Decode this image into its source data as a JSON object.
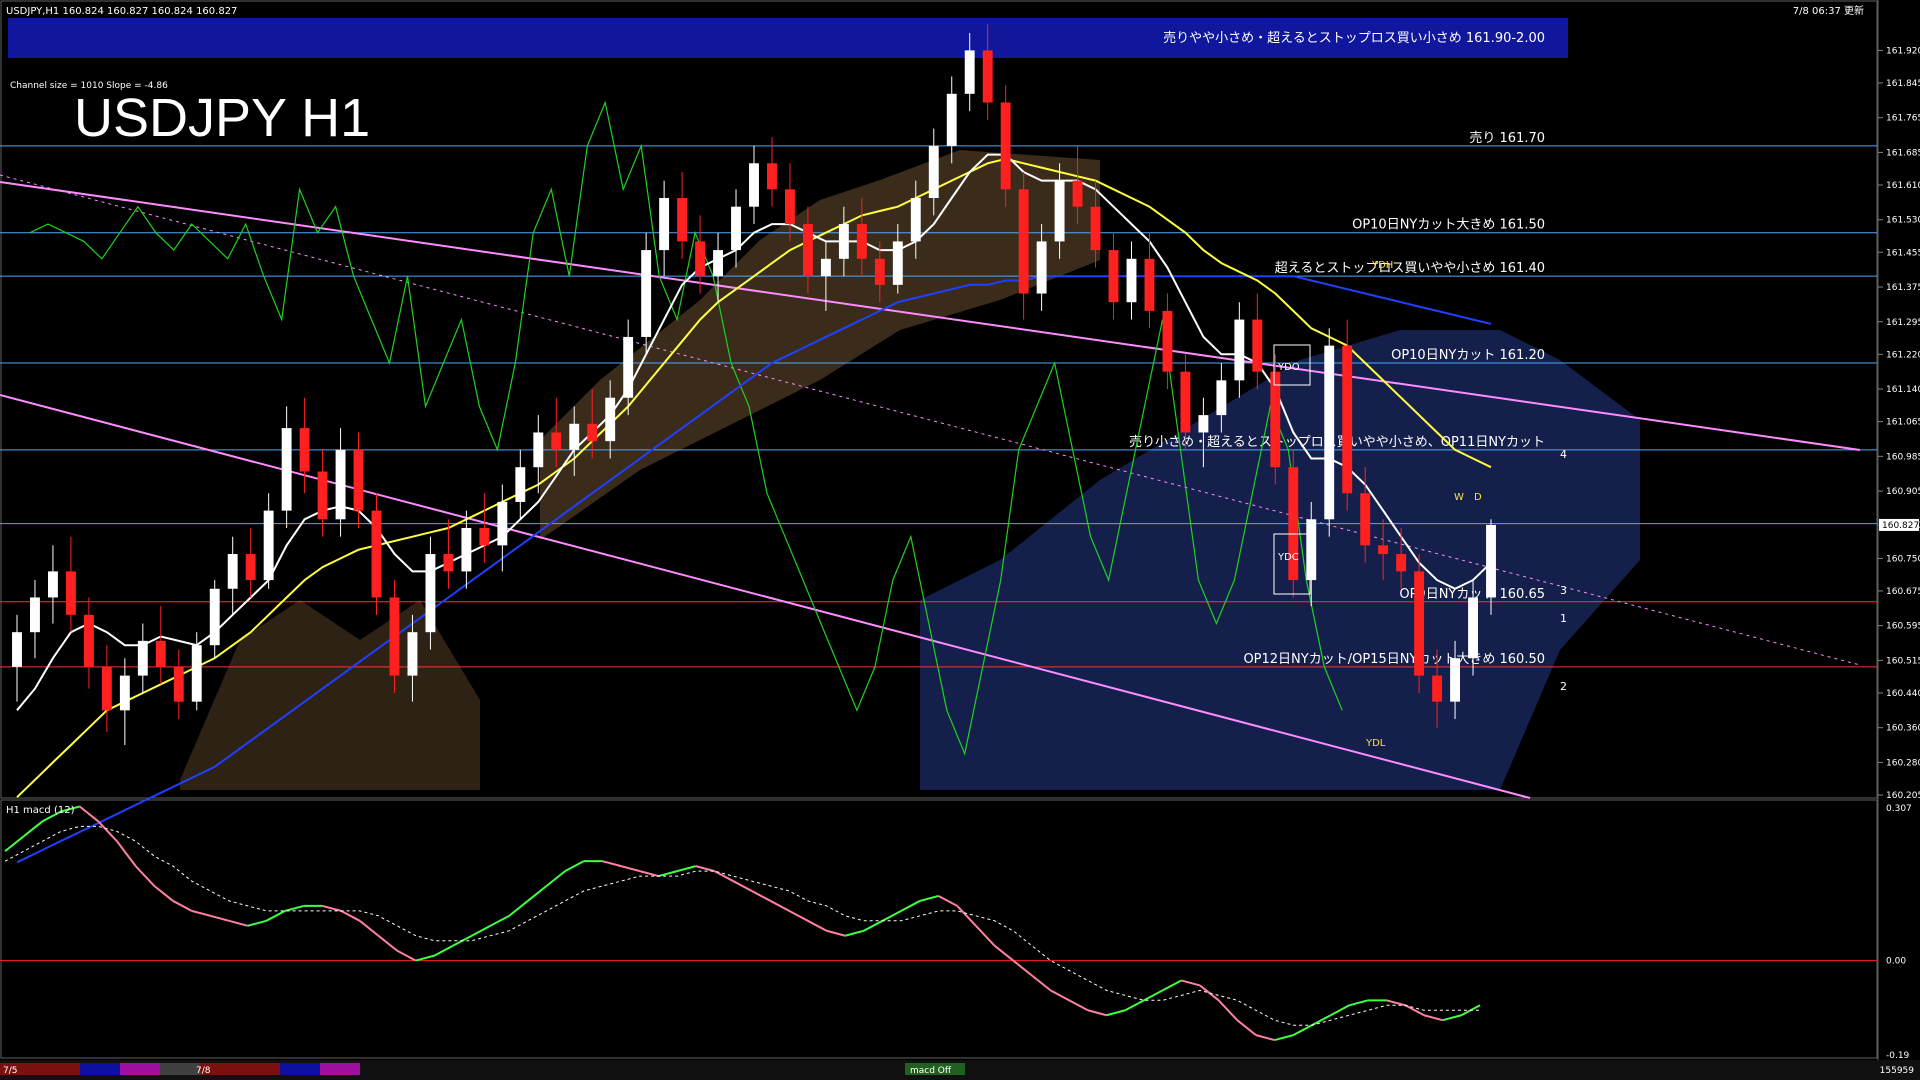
{
  "header": {
    "symbol_info": "USDJPY,H1  160.824 160.827 160.824 160.827",
    "timestamp": "7/8 06:37 更新",
    "channel_info": "Channel size = 1010 Slope = -4.86",
    "big_title": "USDJPY H1"
  },
  "colors": {
    "background": "#000000",
    "bull_candle": "#ffffff",
    "bear_candle": "#ff2020",
    "level_line": "#4aa8ff",
    "red_level": "#ff3030",
    "channel": "#ff8cff",
    "ma_white": "#ffffff",
    "ma_yellow": "#ffff40",
    "ma_blue": "#2040ff",
    "chikou": "#20d020",
    "cloud_blue": "#3a5bd6",
    "cloud_orange": "#d09a60",
    "banner": "#10179c",
    "macd_up": "#40ff40",
    "macd_down": "#ff80a0",
    "signal": "#ffffff"
  },
  "chart_data": [
    {
      "type": "candlestick",
      "title": "USDJPY H1",
      "y_axis_ticks": [
        "161.920",
        "161.845",
        "161.765",
        "161.685",
        "161.610",
        "161.530",
        "161.455",
        "161.375",
        "161.295",
        "161.220",
        "161.140",
        "161.065",
        "160.985",
        "160.905",
        "160.827",
        "160.750",
        "160.675",
        "160.595",
        "160.515",
        "160.440",
        "160.360",
        "160.280",
        "160.205"
      ],
      "ylim": [
        160.205,
        161.99
      ],
      "current_price": "160.827",
      "x_labels": [
        "7/5",
        "7/8"
      ],
      "levels": [
        {
          "label": "売りやや小さめ・超えるとストップロス買い小さめ 161.90-2.00",
          "price": 161.95,
          "kind": "banner"
        },
        {
          "label": "売り 161.70",
          "price": 161.7,
          "kind": "blue"
        },
        {
          "label": "OP10日NYカット大きめ 161.50",
          "price": 161.5,
          "kind": "blue"
        },
        {
          "label": "超えるとストップロス買いやや小さめ 161.40",
          "price": 161.4,
          "kind": "blue"
        },
        {
          "label": "OP10日NYカット 161.20",
          "price": 161.2,
          "kind": "blue"
        },
        {
          "label": "売り小さめ・超えるとストップロス買いやや小さめ、OP11日NYカット",
          "price": 161.0,
          "kind": "blue"
        },
        {
          "label": "",
          "price": 160.83,
          "kind": "blue"
        },
        {
          "label": "OP9日NYカット 160.65",
          "price": 160.65,
          "kind": "red"
        },
        {
          "label": "OP12日NYカット/OP15日NYカット大きめ 160.50",
          "price": 160.5,
          "kind": "red"
        }
      ],
      "box_labels": [
        "YDH",
        "YDO",
        "YDC",
        "YDL",
        "W",
        "D"
      ],
      "wave_labels": [
        "1",
        "2",
        "3",
        "4"
      ],
      "candles": [
        [
          160.5,
          160.62,
          160.42,
          160.58
        ],
        [
          160.58,
          160.7,
          160.52,
          160.66
        ],
        [
          160.66,
          160.78,
          160.6,
          160.72
        ],
        [
          160.72,
          160.8,
          160.58,
          160.62
        ],
        [
          160.62,
          160.66,
          160.45,
          160.5
        ],
        [
          160.5,
          160.55,
          160.35,
          160.4
        ],
        [
          160.4,
          160.52,
          160.32,
          160.48
        ],
        [
          160.48,
          160.6,
          160.44,
          160.56
        ],
        [
          160.56,
          160.64,
          160.46,
          160.5
        ],
        [
          160.5,
          160.54,
          160.38,
          160.42
        ],
        [
          160.42,
          160.58,
          160.4,
          160.55
        ],
        [
          160.55,
          160.7,
          160.52,
          160.68
        ],
        [
          160.68,
          160.8,
          160.62,
          160.76
        ],
        [
          160.76,
          160.82,
          160.66,
          160.7
        ],
        [
          160.7,
          160.9,
          160.68,
          160.86
        ],
        [
          160.86,
          161.1,
          160.82,
          161.05
        ],
        [
          161.05,
          161.12,
          160.9,
          160.95
        ],
        [
          160.95,
          161.0,
          160.8,
          160.84
        ],
        [
          160.84,
          161.05,
          160.8,
          161.0
        ],
        [
          161.0,
          161.04,
          160.82,
          160.86
        ],
        [
          160.86,
          160.9,
          160.62,
          160.66
        ],
        [
          160.66,
          160.7,
          160.44,
          160.48
        ],
        [
          160.48,
          160.62,
          160.42,
          160.58
        ],
        [
          160.58,
          160.8,
          160.54,
          160.76
        ],
        [
          160.76,
          160.84,
          160.68,
          160.72
        ],
        [
          160.72,
          160.86,
          160.68,
          160.82
        ],
        [
          160.82,
          160.9,
          160.74,
          160.78
        ],
        [
          160.78,
          160.92,
          160.72,
          160.88
        ],
        [
          160.88,
          161.0,
          160.84,
          160.96
        ],
        [
          160.96,
          161.08,
          160.9,
          161.04
        ],
        [
          161.04,
          161.12,
          160.96,
          161.0
        ],
        [
          161.0,
          161.1,
          160.94,
          161.06
        ],
        [
          161.06,
          161.14,
          160.98,
          161.02
        ],
        [
          161.02,
          161.16,
          160.98,
          161.12
        ],
        [
          161.12,
          161.3,
          161.08,
          161.26
        ],
        [
          161.26,
          161.5,
          161.22,
          161.46
        ],
        [
          161.46,
          161.62,
          161.4,
          161.58
        ],
        [
          161.58,
          161.64,
          161.44,
          161.48
        ],
        [
          161.48,
          161.54,
          161.36,
          161.4
        ],
        [
          161.4,
          161.5,
          161.34,
          161.46
        ],
        [
          161.46,
          161.6,
          161.42,
          161.56
        ],
        [
          161.56,
          161.7,
          161.52,
          161.66
        ],
        [
          161.66,
          161.72,
          161.56,
          161.6
        ],
        [
          161.6,
          161.66,
          161.48,
          161.52
        ],
        [
          161.52,
          161.56,
          161.36,
          161.4
        ],
        [
          161.4,
          161.48,
          161.32,
          161.44
        ],
        [
          161.44,
          161.56,
          161.4,
          161.52
        ],
        [
          161.52,
          161.58,
          161.4,
          161.44
        ],
        [
          161.44,
          161.48,
          161.34,
          161.38
        ],
        [
          161.38,
          161.52,
          161.36,
          161.48
        ],
        [
          161.48,
          161.62,
          161.44,
          161.58
        ],
        [
          161.58,
          161.74,
          161.54,
          161.7
        ],
        [
          161.7,
          161.86,
          161.66,
          161.82
        ],
        [
          161.82,
          161.96,
          161.78,
          161.92
        ],
        [
          161.92,
          161.98,
          161.76,
          161.8
        ],
        [
          161.8,
          161.84,
          161.56,
          161.6
        ],
        [
          161.6,
          161.64,
          161.3,
          161.36
        ],
        [
          161.36,
          161.52,
          161.32,
          161.48
        ],
        [
          161.48,
          161.66,
          161.44,
          161.62
        ],
        [
          161.62,
          161.7,
          161.52,
          161.56
        ],
        [
          161.56,
          161.62,
          161.42,
          161.46
        ],
        [
          161.46,
          161.5,
          161.3,
          161.34
        ],
        [
          161.34,
          161.48,
          161.3,
          161.44
        ],
        [
          161.44,
          161.5,
          161.28,
          161.32
        ],
        [
          161.32,
          161.36,
          161.14,
          161.18
        ],
        [
          161.18,
          161.22,
          161.0,
          161.04
        ],
        [
          161.04,
          161.12,
          160.96,
          161.08
        ],
        [
          161.08,
          161.2,
          161.04,
          161.16
        ],
        [
          161.16,
          161.34,
          161.12,
          161.3
        ],
        [
          161.3,
          161.36,
          161.14,
          161.18
        ],
        [
          161.18,
          161.22,
          160.92,
          160.96
        ],
        [
          160.96,
          161.0,
          160.66,
          160.7
        ],
        [
          160.7,
          160.88,
          160.64,
          160.84
        ],
        [
          160.84,
          161.28,
          160.8,
          161.24
        ],
        [
          161.24,
          161.3,
          160.86,
          160.9
        ],
        [
          160.9,
          160.96,
          160.74,
          160.78
        ],
        [
          160.78,
          160.84,
          160.7,
          160.76
        ],
        [
          160.76,
          160.82,
          160.68,
          160.72
        ],
        [
          160.72,
          160.76,
          160.44,
          160.48
        ],
        [
          160.48,
          160.54,
          160.36,
          160.42
        ],
        [
          160.42,
          160.56,
          160.38,
          160.52
        ],
        [
          160.52,
          160.7,
          160.48,
          160.66
        ],
        [
          160.66,
          160.84,
          160.62,
          160.827
        ]
      ],
      "ma_white": [
        160.4,
        160.45,
        160.52,
        160.58,
        160.6,
        160.58,
        160.55,
        160.55,
        160.57,
        160.56,
        160.55,
        160.58,
        160.62,
        160.66,
        160.7,
        160.78,
        160.84,
        160.86,
        160.87,
        160.86,
        160.82,
        160.76,
        160.72,
        160.72,
        160.74,
        160.76,
        160.78,
        160.8,
        160.84,
        160.88,
        160.94,
        161.0,
        161.04,
        161.08,
        161.14,
        161.22,
        161.3,
        161.38,
        161.42,
        161.44,
        161.46,
        161.5,
        161.52,
        161.52,
        161.5,
        161.48,
        161.48,
        161.48,
        161.46,
        161.46,
        161.48,
        161.52,
        161.58,
        161.64,
        161.68,
        161.68,
        161.64,
        161.62,
        161.62,
        161.62,
        161.6,
        161.56,
        161.52,
        161.48,
        161.42,
        161.34,
        161.26,
        161.22,
        161.22,
        161.2,
        161.14,
        161.04,
        160.98,
        160.98,
        160.96,
        160.92,
        160.86,
        160.8,
        160.74,
        160.7,
        160.68,
        160.7,
        160.74
      ],
      "ma_yellow": [
        160.2,
        160.24,
        160.28,
        160.32,
        160.36,
        160.4,
        160.42,
        160.44,
        160.46,
        160.48,
        160.5,
        160.52,
        160.55,
        160.58,
        160.62,
        160.66,
        160.7,
        160.73,
        160.75,
        160.77,
        160.78,
        160.79,
        160.8,
        160.81,
        160.82,
        160.84,
        160.86,
        160.88,
        160.9,
        160.92,
        160.95,
        160.98,
        161.02,
        161.06,
        161.1,
        161.15,
        161.2,
        161.25,
        161.3,
        161.34,
        161.37,
        161.4,
        161.43,
        161.46,
        161.48,
        161.5,
        161.52,
        161.54,
        161.55,
        161.56,
        161.58,
        161.6,
        161.62,
        161.64,
        161.66,
        161.67,
        161.66,
        161.65,
        161.64,
        161.63,
        161.62,
        161.6,
        161.58,
        161.56,
        161.53,
        161.5,
        161.46,
        161.43,
        161.41,
        161.39,
        161.36,
        161.32,
        161.28,
        161.26,
        161.24,
        161.2,
        161.16,
        161.12,
        161.08,
        161.04,
        161.0,
        160.98,
        160.96
      ],
      "ma_blue": [
        160.05,
        160.07,
        160.09,
        160.11,
        160.13,
        160.15,
        160.17,
        160.19,
        160.21,
        160.23,
        160.25,
        160.27,
        160.3,
        160.33,
        160.36,
        160.39,
        160.42,
        160.45,
        160.48,
        160.51,
        160.54,
        160.57,
        160.6,
        160.63,
        160.66,
        160.69,
        160.72,
        160.75,
        160.78,
        160.81,
        160.84,
        160.87,
        160.9,
        160.93,
        160.96,
        160.99,
        161.02,
        161.05,
        161.08,
        161.11,
        161.14,
        161.17,
        161.2,
        161.22,
        161.24,
        161.26,
        161.28,
        161.3,
        161.32,
        161.34,
        161.35,
        161.36,
        161.37,
        161.38,
        161.38,
        161.39,
        161.39,
        161.4,
        161.4,
        161.4,
        161.4,
        161.4,
        161.4,
        161.4,
        161.4,
        161.4,
        161.4,
        161.4,
        161.4,
        161.4,
        161.4,
        161.4,
        161.39,
        161.38,
        161.37,
        161.36,
        161.35,
        161.34,
        161.33,
        161.32,
        161.31,
        161.3,
        161.29
      ],
      "chikou": [
        161.5,
        161.52,
        161.5,
        161.48,
        161.44,
        161.5,
        161.56,
        161.5,
        161.46,
        161.52,
        161.48,
        161.44,
        161.52,
        161.4,
        161.3,
        161.6,
        161.5,
        161.56,
        161.4,
        161.3,
        161.2,
        161.4,
        161.1,
        161.2,
        161.3,
        161.1,
        161.0,
        161.2,
        161.5,
        161.6,
        161.4,
        161.7,
        161.8,
        161.6,
        161.7,
        161.4,
        161.3,
        161.5,
        161.4,
        161.2,
        161.1,
        160.9,
        160.8,
        160.7,
        160.6,
        160.5,
        160.4,
        160.5,
        160.7,
        160.8,
        160.6,
        160.4,
        160.3,
        160.5,
        160.7,
        161.0,
        161.1,
        161.2,
        161.0,
        160.8,
        160.7,
        160.9,
        161.1,
        161.3,
        161.0,
        160.7,
        160.6,
        160.7,
        160.9,
        161.1,
        161.0,
        160.7,
        160.5,
        160.4
      ]
    },
    {
      "type": "line",
      "title": "H1  macd (12)",
      "y_axis_ticks": [
        "0.307",
        "0.00",
        "-0.19"
      ],
      "ylim": [
        -0.19,
        0.307
      ],
      "zero_line": 0.0,
      "macd": [
        0.22,
        0.25,
        0.28,
        0.3,
        0.31,
        0.28,
        0.24,
        0.19,
        0.15,
        0.12,
        0.1,
        0.09,
        0.08,
        0.07,
        0.08,
        0.1,
        0.11,
        0.11,
        0.1,
        0.08,
        0.05,
        0.02,
        0.0,
        0.01,
        0.03,
        0.05,
        0.07,
        0.09,
        0.12,
        0.15,
        0.18,
        0.2,
        0.2,
        0.19,
        0.18,
        0.17,
        0.18,
        0.19,
        0.18,
        0.16,
        0.14,
        0.12,
        0.1,
        0.08,
        0.06,
        0.05,
        0.06,
        0.08,
        0.1,
        0.12,
        0.13,
        0.11,
        0.07,
        0.03,
        0.0,
        -0.03,
        -0.06,
        -0.08,
        -0.1,
        -0.11,
        -0.1,
        -0.08,
        -0.06,
        -0.04,
        -0.05,
        -0.08,
        -0.12,
        -0.15,
        -0.16,
        -0.15,
        -0.13,
        -0.11,
        -0.09,
        -0.08,
        -0.08,
        -0.09,
        -0.11,
        -0.12,
        -0.11,
        -0.09
      ],
      "signal": [
        0.2,
        0.22,
        0.24,
        0.26,
        0.27,
        0.27,
        0.26,
        0.24,
        0.21,
        0.19,
        0.16,
        0.14,
        0.12,
        0.11,
        0.1,
        0.1,
        0.1,
        0.1,
        0.1,
        0.1,
        0.09,
        0.07,
        0.05,
        0.04,
        0.04,
        0.04,
        0.05,
        0.06,
        0.08,
        0.1,
        0.12,
        0.14,
        0.15,
        0.16,
        0.17,
        0.17,
        0.17,
        0.18,
        0.18,
        0.17,
        0.16,
        0.15,
        0.14,
        0.12,
        0.11,
        0.09,
        0.08,
        0.08,
        0.08,
        0.09,
        0.1,
        0.1,
        0.09,
        0.08,
        0.06,
        0.03,
        0.0,
        -0.02,
        -0.04,
        -0.06,
        -0.07,
        -0.08,
        -0.08,
        -0.07,
        -0.06,
        -0.07,
        -0.08,
        -0.1,
        -0.12,
        -0.13,
        -0.13,
        -0.12,
        -0.11,
        -0.1,
        -0.09,
        -0.09,
        -0.1,
        -0.1,
        -0.1,
        -0.1
      ]
    }
  ],
  "footer": {
    "date_tabs": [
      "7/5",
      "7/8"
    ],
    "indicator_tag": "macd Off",
    "right_info": "155959"
  }
}
